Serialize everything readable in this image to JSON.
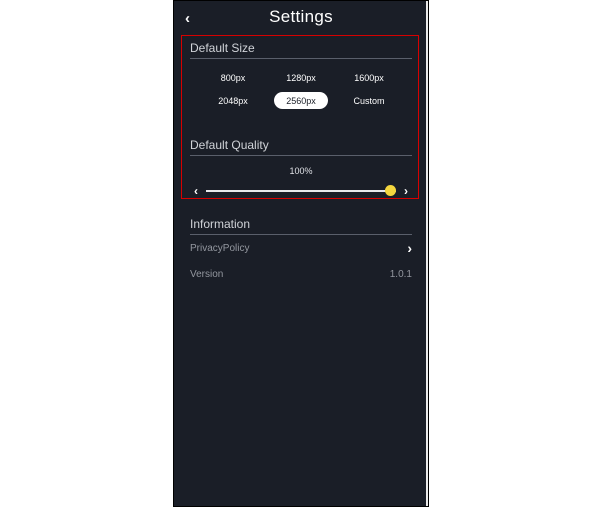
{
  "header": {
    "title": "Settings"
  },
  "size": {
    "title": "Default Size",
    "options": [
      "800px",
      "1280px",
      "1600px",
      "2048px",
      "2560px",
      "Custom"
    ],
    "selected": "2560px"
  },
  "quality": {
    "title": "Default Quality",
    "value_label": "100%",
    "percent": 100
  },
  "info": {
    "title": "Information",
    "privacy_label": "PrivacyPolicy",
    "version_label": "Version",
    "version_value": "1.0.1"
  },
  "highlight_color": "#d60000",
  "slider_thumb_color": "#f4d63e"
}
